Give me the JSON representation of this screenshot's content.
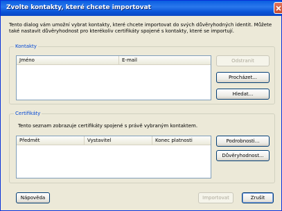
{
  "window": {
    "title": "Zvolte kontakty, které chcete importovat"
  },
  "intro_text": "Tento dialog vám umožní vybrat kontakty, které chcete importovat do svých důvěryhodných identit. Můžete také nastavit důvěryhodnost pro kterékoliv certifikáty spojené s kontakty, které se importují.",
  "contacts": {
    "legend": "Kontakty",
    "columns": [
      "Jméno",
      "E-mail"
    ],
    "buttons": {
      "remove": "Odstranit",
      "browse": "Procházet...",
      "search": "Hledat..."
    }
  },
  "certificates": {
    "legend": "Certifikáty",
    "description": "Tento seznam zobrazuje certifikáty spojené s právě vybraným kontaktem.",
    "columns": [
      "Předmět",
      "Vystavitel",
      "Konec platnosti"
    ],
    "buttons": {
      "details": "Podrobnosti...",
      "trust": "Důvěryhodnost..."
    }
  },
  "footer": {
    "help": "Nápověda",
    "import": "Importovat",
    "cancel": "Zrušit"
  }
}
